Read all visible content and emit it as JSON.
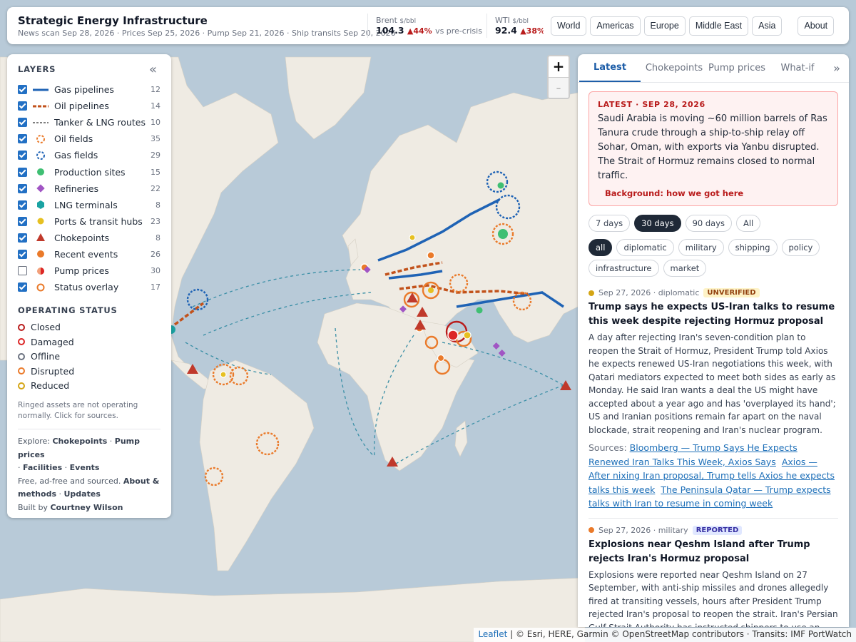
{
  "header": {
    "title": "Strategic Energy Infrastructure",
    "subtitle": "News scan Sep 28, 2026 · Prices Sep 25, 2026 · Pump Sep 21, 2026 · Ship transits Sep 20, 2026",
    "brent": {
      "label": "Brent",
      "unit": "$/bbl",
      "value": "104.3",
      "change": "▲44%",
      "vs": "vs pre-crisis"
    },
    "wti": {
      "label": "WTI",
      "unit": "$/bbl",
      "value": "92.4",
      "change": "▲38%",
      "vs": "v"
    },
    "regions": [
      "World",
      "Americas",
      "Europe",
      "Middle East",
      "Asia"
    ],
    "about": "About"
  },
  "layers": {
    "heading": "LAYERS",
    "collapse": "«",
    "items": [
      {
        "label": "Gas pipelines",
        "count": "12",
        "checked": true,
        "swatch": "gas-pipe"
      },
      {
        "label": "Oil pipelines",
        "count": "14",
        "checked": true,
        "swatch": "oil-pipe"
      },
      {
        "label": "Tanker & LNG routes",
        "count": "10",
        "checked": true,
        "swatch": "route"
      },
      {
        "label": "Oil fields",
        "count": "35",
        "checked": true,
        "swatch": "oil-field"
      },
      {
        "label": "Gas fields",
        "count": "29",
        "checked": true,
        "swatch": "gas-field"
      },
      {
        "label": "Production sites",
        "count": "15",
        "checked": true,
        "swatch": "production"
      },
      {
        "label": "Refineries",
        "count": "22",
        "checked": true,
        "swatch": "refinery"
      },
      {
        "label": "LNG terminals",
        "count": "8",
        "checked": true,
        "swatch": "lng"
      },
      {
        "label": "Ports & transit hubs",
        "count": "23",
        "checked": true,
        "swatch": "port"
      },
      {
        "label": "Chokepoints",
        "count": "8",
        "checked": true,
        "swatch": "chokepoint"
      },
      {
        "label": "Recent events",
        "count": "26",
        "checked": true,
        "swatch": "event"
      },
      {
        "label": "Pump prices",
        "count": "30",
        "checked": false,
        "swatch": "pump"
      },
      {
        "label": "Status overlay",
        "count": "17",
        "checked": true,
        "swatch": "status"
      }
    ],
    "status_heading": "OPERATING STATUS",
    "statuses": [
      {
        "label": "Closed",
        "color": "#b91c1c"
      },
      {
        "label": "Damaged",
        "color": "#dc2626"
      },
      {
        "label": "Offline",
        "color": "#6b7280"
      },
      {
        "label": "Disrupted",
        "color": "#ea7a2a"
      },
      {
        "label": "Reduced",
        "color": "#d4a514"
      }
    ],
    "note": "Ringed assets are not operating normally. Click for sources.",
    "footer": {
      "explore": "Explore:",
      "link_chokepoints": "Chokepoints",
      "link_pump": "Pump prices",
      "link_facilities": "Facilities",
      "link_events": "Events",
      "free": "Free, ad-free and sourced.",
      "link_about": "About & methods",
      "link_updates": "Updates",
      "built": "Built by",
      "author": "Courtney Wilson"
    }
  },
  "zoom": {
    "in": "+",
    "out": "-"
  },
  "panel": {
    "tabs": [
      "Latest",
      "Chokepoints",
      "Pump prices",
      "What-if"
    ],
    "more": "»",
    "alert": {
      "heading": "LATEST · SEP 28, 2026",
      "text": "Saudi Arabia is moving ~60 million barrels of Ras Tanura crude through a ship-to-ship relay off Sohar, Oman, with exports via Yanbu disrupted. The Strait of Hormuz remains closed to normal traffic.",
      "link": "Background: how we got here"
    },
    "ranges": [
      "7 days",
      "30 days",
      "90 days",
      "All"
    ],
    "categories": [
      "all",
      "diplomatic",
      "military",
      "shipping",
      "policy",
      "infrastructure",
      "market"
    ],
    "news": [
      {
        "meta": "Sep 27, 2026 · diplomatic",
        "dot": "#d4a514",
        "badge": "UNVERIFIED",
        "title": "Trump says he expects US-Iran talks to resume this week despite rejecting Hormuz proposal",
        "body": "A day after rejecting Iran's seven-condition plan to reopen the Strait of Hormuz, President Trump told Axios he expects renewed US-Iran negotiations this week, with Qatari mediators expected to meet both sides as early as Monday. He said Iran wants a deal the US might have accepted about a year ago and has 'overplayed its hand'; US and Iranian positions remain far apart on the naval blockade, strait reopening and Iran's nuclear program.",
        "sources_label": "Sources:",
        "sources": [
          "Bloomberg — Trump Says He Expects Renewed Iran Talks This Week, Axios Says",
          "Axios — After nixing Iran proposal, Trump tells Axios he expects talks this week",
          "The Peninsula Qatar — Trump expects talks with Iran to resume in coming week"
        ]
      },
      {
        "meta": "Sep 27, 2026 · military",
        "dot": "#ea7a2a",
        "badge": "REPORTED",
        "title": "Explosions near Qeshm Island after Trump rejects Iran's Hormuz proposal",
        "body": "Explosions were reported near Qeshm Island on 27 September, with anti-ship missiles and drones allegedly fired at transiting vessels, hours after President Trump rejected Iran's proposal to reopen the strait. Iran's Persian Gulf Strait Authority has instructed shippers to use an Iranian-approved"
      }
    ]
  },
  "attribution": {
    "leaflet": "Leaflet",
    "text": "| © Esri, HERE, Garmin © OpenStreetMap contributors · Transits: IMF PortWatch"
  },
  "colors": {
    "gas": "#1f63b5",
    "oil": "#c2521b",
    "route": "#3a8fa6",
    "ocean": "#b8cad8",
    "land": "#efebe3",
    "accent": "#1e5ea8"
  }
}
